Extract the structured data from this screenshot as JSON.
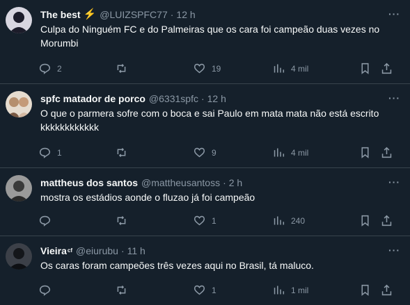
{
  "tweets": [
    {
      "name": "The best",
      "badge": "⚡",
      "handle": "@LUIZSPFC77",
      "time": "12 h",
      "text": "Culpa do Ninguém FC e do Palmeiras que os cara foi campeão duas vezes no Morumbi",
      "replies": "2",
      "retweets": "",
      "likes": "19",
      "views": "4 mil",
      "avatar_color": "#1c1c2a"
    },
    {
      "name": "spfc matador de porco",
      "badge": "",
      "handle": "@6331spfc",
      "time": "12 h",
      "text": "O que o parmera sofre com o boca e sai Paulo em mata mata não está escrito kkkkkkkkkkkk",
      "replies": "1",
      "retweets": "",
      "likes": "9",
      "views": "4 mil",
      "avatar_color": "#d9c9b6"
    },
    {
      "name": "mattheus dos santos",
      "badge": "",
      "handle": "@mattheusantoss",
      "time": "2 h",
      "text": "mostra os estádios aonde o fluzao já foi campeão",
      "replies": "",
      "retweets": "",
      "likes": "1",
      "views": "240",
      "avatar_color": "#7a7a7a"
    },
    {
      "name": "Vieira",
      "badge": "cf",
      "handle": "@eiurubu",
      "time": "11 h",
      "text": "Os caras foram campeões três vezes aqui no Brasil, tá maluco.",
      "replies": "",
      "retweets": "",
      "likes": "1",
      "views": "1 mil",
      "avatar_color": "#2a2d33"
    }
  ],
  "separator": "·",
  "more_label": "···"
}
